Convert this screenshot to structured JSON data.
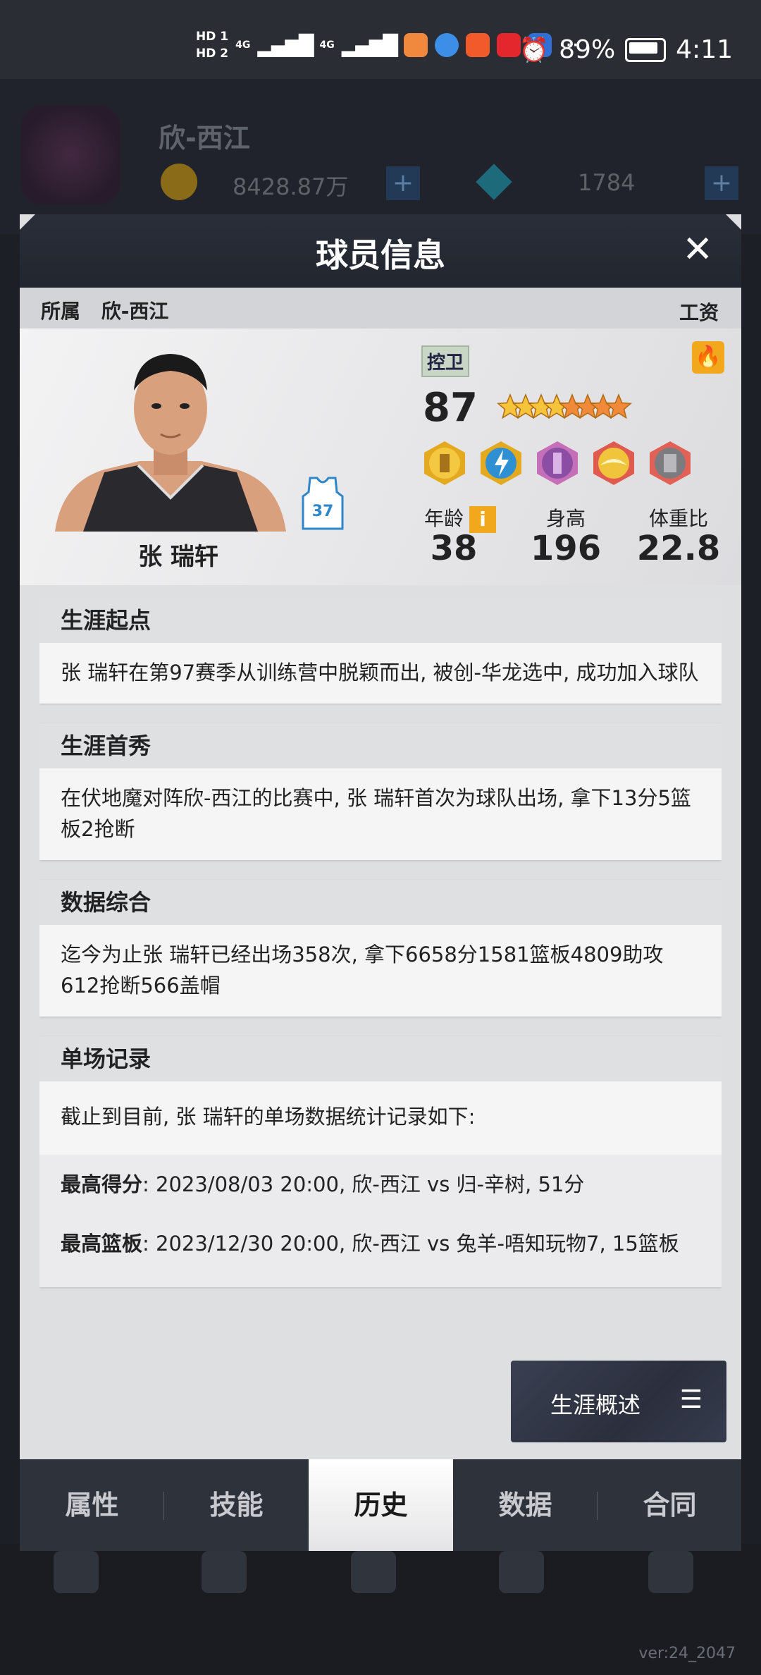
{
  "status_bar": {
    "hd1": "HD 1",
    "hd2": "HD 2",
    "net1": "4G",
    "net2": "4G",
    "more": "···",
    "battery": "89%",
    "time": "4:11"
  },
  "background": {
    "team": "欣-西江",
    "coins": "8428.87万",
    "gems": "1784",
    "version": "ver:24_2047"
  },
  "dialog": {
    "title": "球员信息",
    "close_glyph": "✕",
    "belongs_label": "所属",
    "belongs_team": "欣-西江",
    "salary_label": "工资",
    "player": {
      "name": "张 瑞轩",
      "jersey": "37",
      "position": "控卫",
      "rating": "87",
      "stars_total": 8,
      "stars_gold": 4,
      "age_label": "年龄",
      "age": "38",
      "height_label": "身高",
      "height": "196",
      "bmi_label": "体重比",
      "bmi": "22.8",
      "info_glyph": "i",
      "fire_glyph": "🔥"
    }
  },
  "history": {
    "career_start": {
      "title": "生涯起点",
      "text": "张 瑞轩在第97赛季从训练营中脱颖而出, 被创-华龙选中, 成功加入球队"
    },
    "debut": {
      "title": "生涯首秀",
      "text": "在伏地魔对阵欣-西江的比赛中, 张 瑞轩首次为球队出场, 拿下13分5篮板2抢断"
    },
    "summary": {
      "title": "数据综合",
      "text": "迄今为止张 瑞轩已经出场358次, 拿下6658分1581篮板4809助攻612抢断566盖帽"
    },
    "records": {
      "title": "单场记录",
      "intro": "截止到目前, 张 瑞轩的单场数据统计记录如下:",
      "items": [
        {
          "label": "最高得分",
          "text": ": 2023/08/03 20:00, 欣-西江 vs 归-辛树, 51分"
        },
        {
          "label": "最高篮板",
          "text": ": 2023/12/30 20:00, 欣-西江 vs 兔羊-唔知玩物7, 15篮板"
        }
      ]
    }
  },
  "career_button": {
    "label": "生涯概述",
    "menu_glyph": "☰"
  },
  "tabs": [
    {
      "label": "属性",
      "active": false
    },
    {
      "label": "技能",
      "active": false
    },
    {
      "label": "历史",
      "active": true
    },
    {
      "label": "数据",
      "active": false
    },
    {
      "label": "合同",
      "active": false
    }
  ],
  "colors": {
    "accent_gold": "#f2a81c",
    "header_dark": "#2a2e38",
    "panel_bg": "#dedfe1"
  }
}
